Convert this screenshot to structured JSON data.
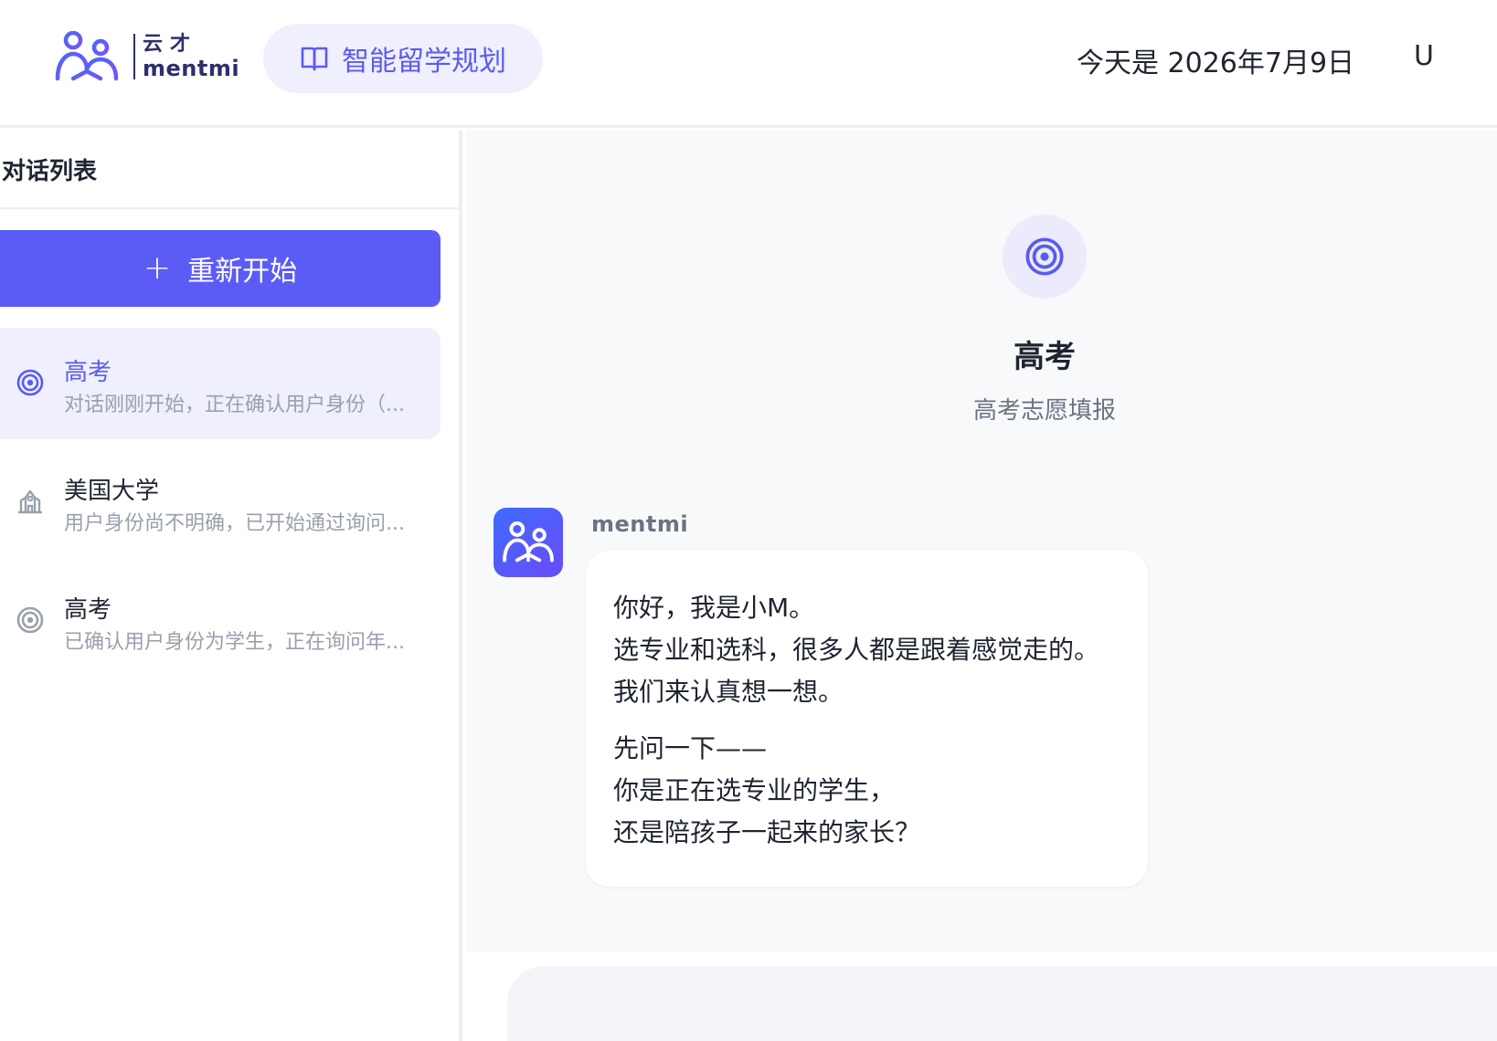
{
  "header": {
    "logo_cn": "云才",
    "logo_en": "mentmi",
    "nav_pill_label": "智能留学规划",
    "date_text": "今天是 2026年7月9日",
    "user_peek": "U"
  },
  "sidebar": {
    "title": "对话列表",
    "new_button_label": "重新开始",
    "conversations": [
      {
        "title": "高考",
        "subtitle": "对话刚刚开始，正在确认用户身份（...",
        "icon": "target-icon",
        "active": true
      },
      {
        "title": "美国大学",
        "subtitle": "用户身份尚不明确，已开始通过询问...",
        "icon": "university-icon",
        "active": false
      },
      {
        "title": "高考",
        "subtitle": "已确认用户身份为学生，正在询问年...",
        "icon": "target-icon",
        "active": false
      }
    ]
  },
  "main": {
    "topic_title": "高考",
    "topic_subtitle": "高考志愿填报",
    "message": {
      "sender": "mentmi",
      "paragraphs": [
        [
          "你好，我是小M。",
          "选专业和选科，很多人都是跟着感觉走的。",
          "我们来认真想一想。"
        ],
        [
          "先问一下——",
          "你是正在选专业的学生，",
          "还是陪孩子一起来的家长？"
        ]
      ]
    }
  },
  "colors": {
    "accent": "#5b5cf6",
    "accent_soft": "#efeffd",
    "logo_navy": "#2c2f6b"
  }
}
